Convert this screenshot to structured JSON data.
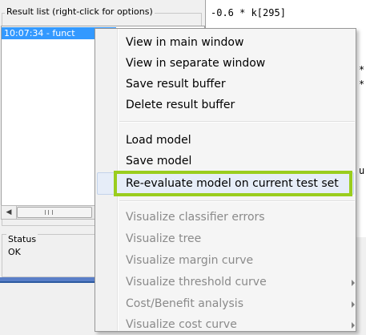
{
  "result_list": {
    "legend": "Result list (right-click for options)",
    "selected_item": "10:07:34 - funct"
  },
  "status": {
    "legend": "Status",
    "text": "OK"
  },
  "output": {
    "first_line": "-0.6 * k[295]",
    "frag_1": "*",
    "frag_2": "*",
    "frag_3": "u"
  },
  "context_menu": {
    "items": [
      {
        "label": "View in main window",
        "enabled": true
      },
      {
        "label": "View in separate window",
        "enabled": true
      },
      {
        "label": "Save result buffer",
        "enabled": true
      },
      {
        "label": "Delete result buffer",
        "enabled": true
      },
      {
        "label": "Load model",
        "enabled": true
      },
      {
        "label": "Save model",
        "enabled": true
      },
      {
        "label": "Re-evaluate model on current test set",
        "enabled": true,
        "highlighted": true
      },
      {
        "label": "Visualize classifier errors",
        "enabled": false
      },
      {
        "label": "Visualize tree",
        "enabled": false
      },
      {
        "label": "Visualize margin curve",
        "enabled": false
      },
      {
        "label": "Visualize threshold curve",
        "enabled": false,
        "submenu": true
      },
      {
        "label": "Cost/Benefit analysis",
        "enabled": false,
        "submenu": true
      },
      {
        "label": "Visualize cost curve",
        "enabled": false,
        "submenu": true
      }
    ]
  },
  "colors": {
    "selection": "#3399ff",
    "highlight_border": "#9acd1e"
  }
}
